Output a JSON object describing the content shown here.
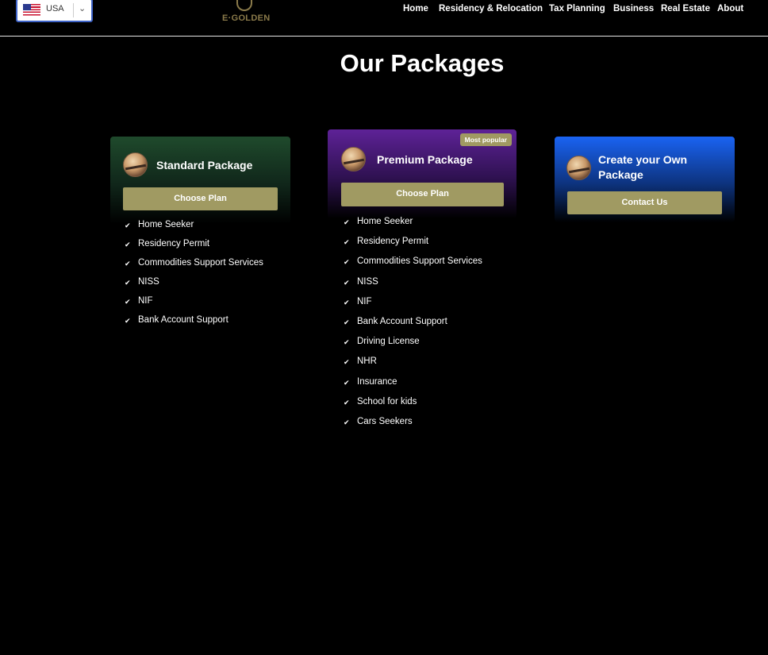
{
  "header": {
    "language": {
      "label": "USA",
      "flag": "us-flag-icon"
    },
    "logo_text": "E·GOLDEN",
    "nav": [
      "Home",
      "Residency & Relocation",
      "Tax Planning",
      "Business",
      "Real Estate",
      "About"
    ]
  },
  "main": {
    "title": "Our Packages",
    "packages": [
      {
        "name": "Standard Package",
        "button": "Choose Plan",
        "features": [
          "Home Seeker",
          "Residency Permit",
          "Commodities Support Services",
          "NISS",
          "NIF",
          "Bank Account Support"
        ]
      },
      {
        "name": "Premium Package",
        "badge": "Most popular",
        "button": "Choose Plan",
        "features": [
          "Home Seeker",
          "Residency Permit",
          "Commodities Support Services",
          "NISS",
          "NIF",
          "Bank Account Support",
          "Driving License",
          "NHR",
          "Insurance",
          "School for kids",
          "Cars Seekers"
        ]
      },
      {
        "name": "Create your Own Package",
        "button": "Contact Us",
        "features": []
      }
    ]
  },
  "colors": {
    "background": "#000000",
    "standard_header": "#1f4a2c",
    "premium_header": "#5e2297",
    "custom_header": "#1a63f2",
    "button": "#a09a62",
    "language_border": "#3f64c8"
  }
}
